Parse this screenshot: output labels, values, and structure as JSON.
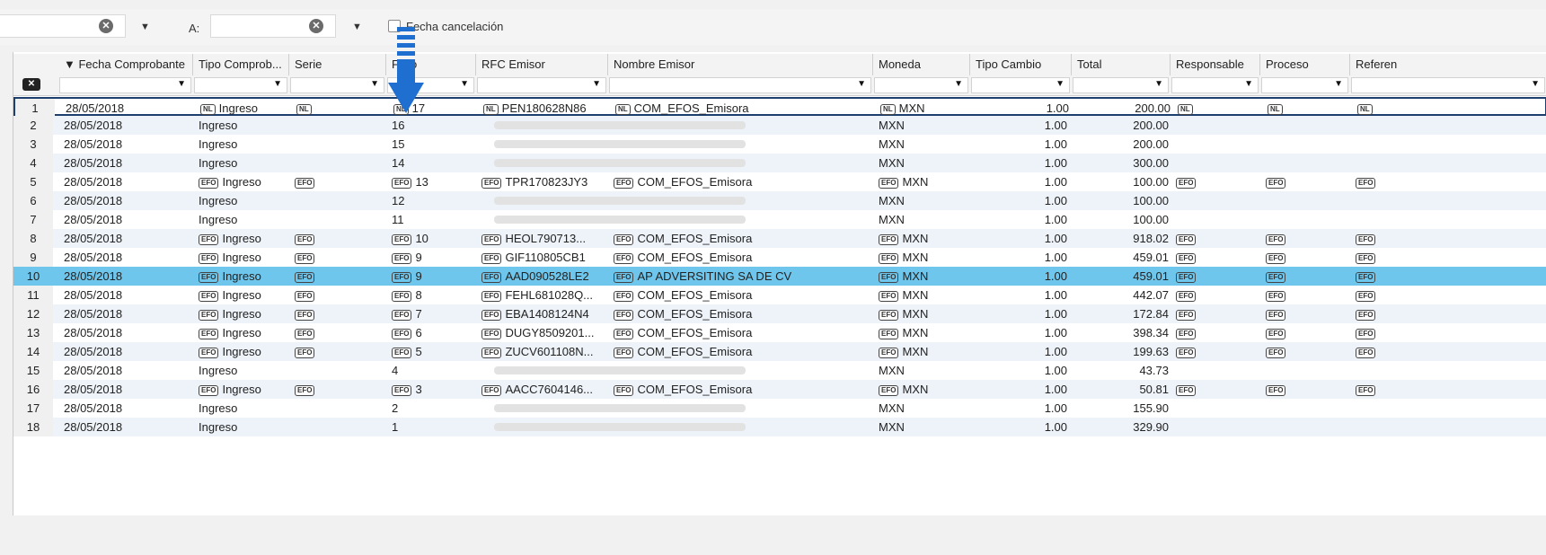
{
  "toolbar": {
    "a_label": "A:",
    "fecha_cancelacion_label": "Fecha cancelación",
    "clear_symbol": "✕",
    "caret_symbol": "▼"
  },
  "grid": {
    "columns": [
      {
        "key": "fecha",
        "label": "▼ Fecha Comprobante"
      },
      {
        "key": "tipo",
        "label": "Tipo Comprob..."
      },
      {
        "key": "serie",
        "label": "Serie"
      },
      {
        "key": "folio",
        "label": "Folio"
      },
      {
        "key": "rfc",
        "label": "RFC Emisor"
      },
      {
        "key": "nombre",
        "label": "Nombre Emisor"
      },
      {
        "key": "moneda",
        "label": "Moneda"
      },
      {
        "key": "tipo_cambio",
        "label": "Tipo Cambio"
      },
      {
        "key": "total",
        "label": "Total"
      },
      {
        "key": "responsable",
        "label": "Responsable"
      },
      {
        "key": "proceso",
        "label": "Proceso"
      },
      {
        "key": "referencia",
        "label": "Referen"
      }
    ],
    "clear_filter_label": "✕",
    "rows": [
      {
        "n": "1",
        "fecha": "28/05/2018",
        "tipo": "Ingreso",
        "folio": "17",
        "rfc": "PEN180628N86",
        "nombre": "COM_EFOS_Emisora",
        "moneda": "MXN",
        "tipo_cambio": "1.00",
        "total": "200.00",
        "badge": "NL"
      },
      {
        "n": "2",
        "fecha": "28/05/2018",
        "tipo": "Ingreso",
        "folio": "16",
        "rfc": "",
        "nombre": "",
        "moneda": "MXN",
        "tipo_cambio": "1.00",
        "total": "200.00",
        "badge": ""
      },
      {
        "n": "3",
        "fecha": "28/05/2018",
        "tipo": "Ingreso",
        "folio": "15",
        "rfc": "",
        "nombre": "",
        "moneda": "MXN",
        "tipo_cambio": "1.00",
        "total": "200.00",
        "badge": ""
      },
      {
        "n": "4",
        "fecha": "28/05/2018",
        "tipo": "Ingreso",
        "folio": "14",
        "rfc": "",
        "nombre": "",
        "moneda": "MXN",
        "tipo_cambio": "1.00",
        "total": "300.00",
        "badge": ""
      },
      {
        "n": "5",
        "fecha": "28/05/2018",
        "tipo": "Ingreso",
        "folio": "13",
        "rfc": "TPR170823JY3",
        "nombre": "COM_EFOS_Emisora",
        "moneda": "MXN",
        "tipo_cambio": "1.00",
        "total": "100.00",
        "badge": "EFO"
      },
      {
        "n": "6",
        "fecha": "28/05/2018",
        "tipo": "Ingreso",
        "folio": "12",
        "rfc": "",
        "nombre": "",
        "moneda": "MXN",
        "tipo_cambio": "1.00",
        "total": "100.00",
        "badge": ""
      },
      {
        "n": "7",
        "fecha": "28/05/2018",
        "tipo": "Ingreso",
        "folio": "11",
        "rfc": "",
        "nombre": "",
        "moneda": "MXN",
        "tipo_cambio": "1.00",
        "total": "100.00",
        "badge": ""
      },
      {
        "n": "8",
        "fecha": "28/05/2018",
        "tipo": "Ingreso",
        "folio": "10",
        "rfc": "HEOL790713...",
        "nombre": "COM_EFOS_Emisora",
        "moneda": "MXN",
        "tipo_cambio": "1.00",
        "total": "918.02",
        "badge": "EFO"
      },
      {
        "n": "9",
        "fecha": "28/05/2018",
        "tipo": "Ingreso",
        "folio": "9",
        "rfc": "GIF110805CB1",
        "nombre": "COM_EFOS_Emisora",
        "moneda": "MXN",
        "tipo_cambio": "1.00",
        "total": "459.01",
        "badge": "EFO"
      },
      {
        "n": "10",
        "fecha": "28/05/2018",
        "tipo": "Ingreso",
        "folio": "9",
        "rfc": "AAD090528LE2",
        "nombre": "AP ADVERSITING SA DE CV",
        "moneda": "MXN",
        "tipo_cambio": "1.00",
        "total": "459.01",
        "badge": "EFO"
      },
      {
        "n": "11",
        "fecha": "28/05/2018",
        "tipo": "Ingreso",
        "folio": "8",
        "rfc": "FEHL681028Q...",
        "nombre": "COM_EFOS_Emisora",
        "moneda": "MXN",
        "tipo_cambio": "1.00",
        "total": "442.07",
        "badge": "EFO"
      },
      {
        "n": "12",
        "fecha": "28/05/2018",
        "tipo": "Ingreso",
        "folio": "7",
        "rfc": "EBA1408124N4",
        "nombre": "COM_EFOS_Emisora",
        "moneda": "MXN",
        "tipo_cambio": "1.00",
        "total": "172.84",
        "badge": "EFO"
      },
      {
        "n": "13",
        "fecha": "28/05/2018",
        "tipo": "Ingreso",
        "folio": "6",
        "rfc": "DUGY8509201...",
        "nombre": "COM_EFOS_Emisora",
        "moneda": "MXN",
        "tipo_cambio": "1.00",
        "total": "398.34",
        "badge": "EFO"
      },
      {
        "n": "14",
        "fecha": "28/05/2018",
        "tipo": "Ingreso",
        "folio": "5",
        "rfc": "ZUCV601108N...",
        "nombre": "COM_EFOS_Emisora",
        "moneda": "MXN",
        "tipo_cambio": "1.00",
        "total": "199.63",
        "badge": "EFO"
      },
      {
        "n": "15",
        "fecha": "28/05/2018",
        "tipo": "Ingreso",
        "folio": "4",
        "rfc": "",
        "nombre": "",
        "moneda": "MXN",
        "tipo_cambio": "1.00",
        "total": "43.73",
        "badge": ""
      },
      {
        "n": "16",
        "fecha": "28/05/2018",
        "tipo": "Ingreso",
        "folio": "3",
        "rfc": "AACC7604146...",
        "nombre": "COM_EFOS_Emisora",
        "moneda": "MXN",
        "tipo_cambio": "1.00",
        "total": "50.81",
        "badge": "EFO"
      },
      {
        "n": "17",
        "fecha": "28/05/2018",
        "tipo": "Ingreso",
        "folio": "2",
        "rfc": "",
        "nombre": "",
        "moneda": "MXN",
        "tipo_cambio": "1.00",
        "total": "155.90",
        "badge": ""
      },
      {
        "n": "18",
        "fecha": "28/05/2018",
        "tipo": "Ingreso",
        "folio": "1",
        "rfc": "",
        "nombre": "",
        "moneda": "MXN",
        "tipo_cambio": "1.00",
        "total": "329.90",
        "badge": ""
      }
    ],
    "selected_row": "10"
  },
  "colors": {
    "selected_row": "#6fc6ec",
    "alt_row": "#edf3f8",
    "annotation_arrow": "#1e6fd0"
  }
}
